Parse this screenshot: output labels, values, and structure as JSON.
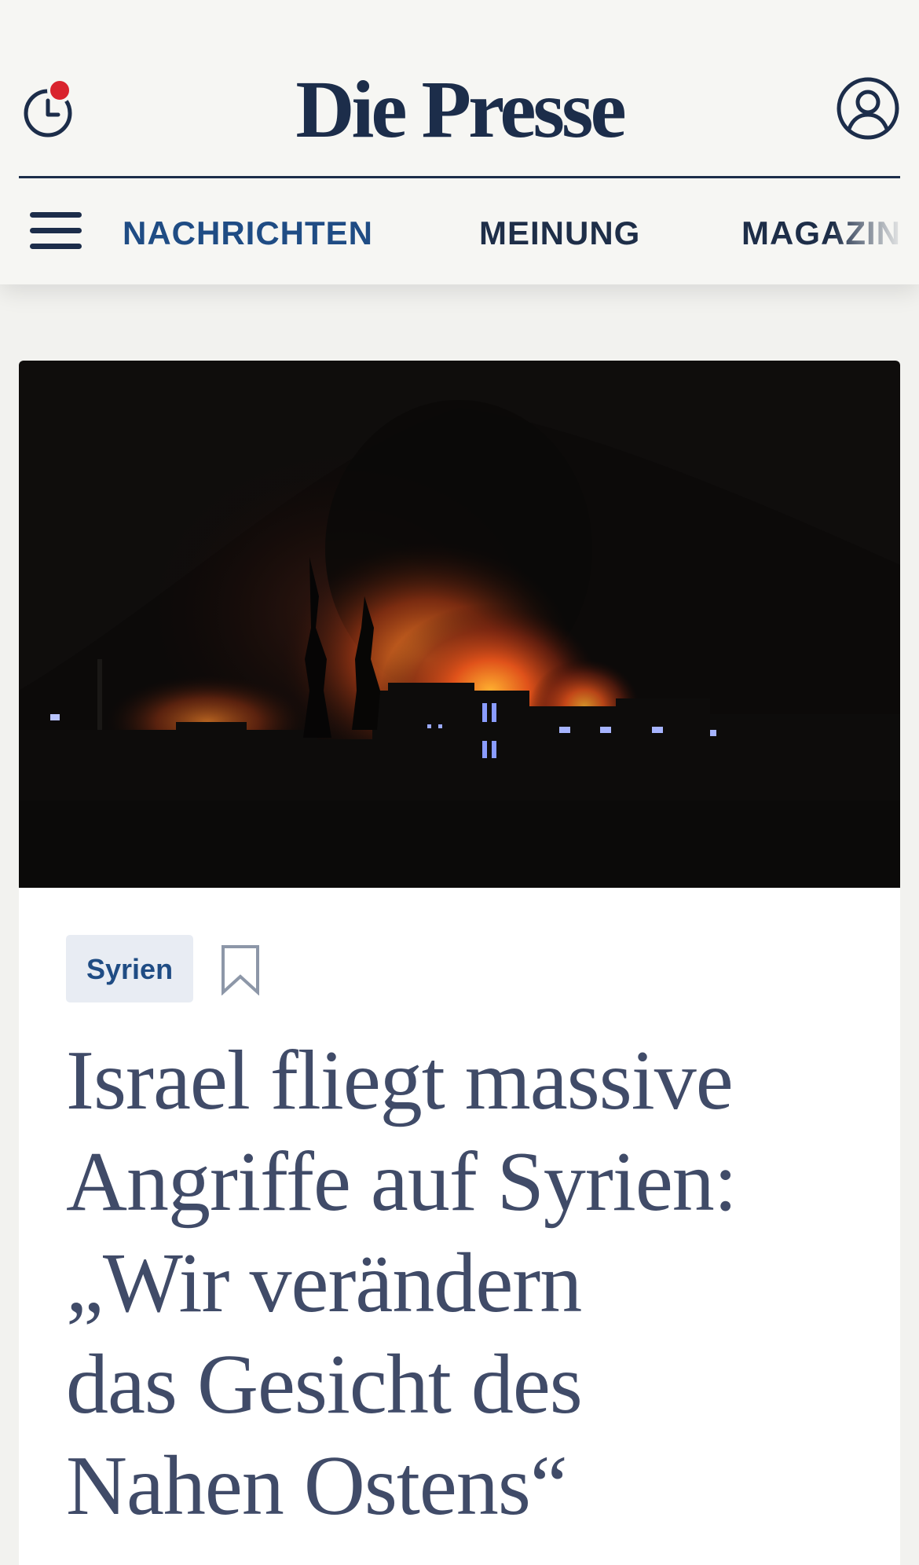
{
  "header": {
    "logo_text": "Die Presse",
    "history_icon": "clock-history-icon",
    "account_icon": "user-account-icon",
    "menu_icon": "hamburger-menu-icon",
    "notification_color": "#d9232d",
    "brand_color": "#1c2d4a"
  },
  "nav": {
    "items": [
      {
        "label": "NACHRICHTEN",
        "active": true
      },
      {
        "label": "MEINUNG",
        "active": false
      },
      {
        "label": "MAGAZIN",
        "active": false
      }
    ],
    "active_color": "#1f4c84"
  },
  "article": {
    "image_icon": "night-fire-photo",
    "tag": "Syrien",
    "bookmark_icon": "bookmark-icon",
    "headline_lines": [
      "Israel fliegt massive",
      "Angriffe auf Syrien:",
      "„Wir verändern",
      "das Gesicht des",
      "Nahen Ostens“"
    ],
    "headline_color": "#404b68"
  }
}
